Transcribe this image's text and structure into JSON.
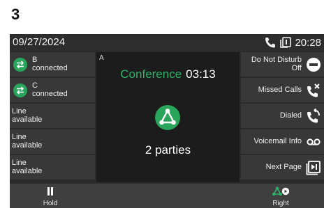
{
  "figure_label": "3",
  "status_bar": {
    "date": "09/27/2024",
    "time": "20:28",
    "icons": [
      "phone-icon",
      "copy-icon"
    ]
  },
  "lines_left": [
    {
      "line1": "B",
      "line2": "connected",
      "icon": "transfer-icon",
      "badge_color": "#2aa55c"
    },
    {
      "line1": "C",
      "line2": "connected",
      "icon": "transfer-icon",
      "badge_color": "#2aa55c"
    },
    {
      "line1": "Line",
      "line2": "available"
    },
    {
      "line1": "Line",
      "line2": "available"
    },
    {
      "line1": "Line",
      "line2": "available"
    }
  ],
  "main": {
    "line_letter": "A",
    "conference_label": "Conference",
    "conference_time": "03:13",
    "parties": "2 parties",
    "accent_color": "#2fb36a"
  },
  "features_right": [
    {
      "line1": "Do Not Disturb",
      "line2": "Off",
      "icon": "dnd-icon"
    },
    {
      "line1": "Missed Calls",
      "icon": "missed-calls-icon"
    },
    {
      "line1": "Dialed",
      "icon": "dialed-icon"
    },
    {
      "line1": "Voicemail Info",
      "icon": "voicemail-icon"
    },
    {
      "line1": "Next Page",
      "icon": "next-page-icon"
    }
  ],
  "softkeys": [
    {
      "label": "Hold",
      "icon": "pause-icon"
    },
    {
      "label": "Right",
      "icon": "conference-right-icon"
    }
  ]
}
